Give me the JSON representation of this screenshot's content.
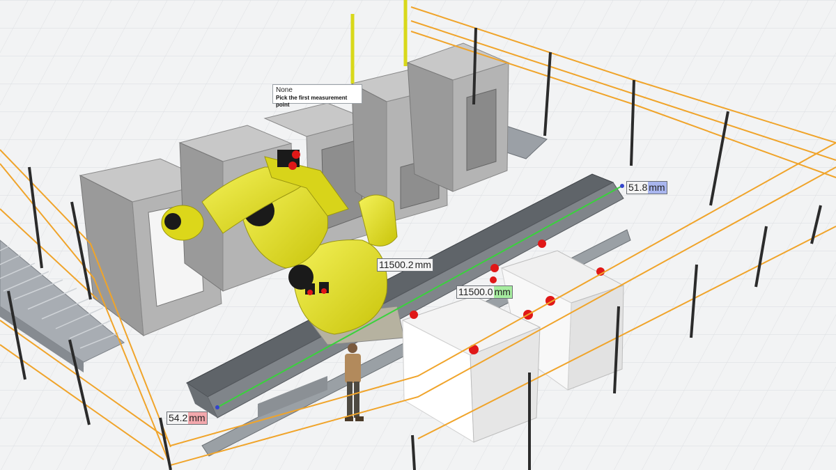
{
  "tooltip": {
    "title": "None",
    "instruction": "Pick the first measurement point"
  },
  "measurements": [
    {
      "id": "start-offset",
      "value": "54.2",
      "unit": "mm",
      "unit_color": "#f3a8ad"
    },
    {
      "id": "end-offset",
      "value": "51.8",
      "unit": "mm",
      "unit_color": "#a9b6ef"
    },
    {
      "id": "rail-length",
      "value": "11500.2",
      "unit": "mm",
      "unit_color": "#f4f4f4"
    },
    {
      "id": "measured-distance",
      "value": "11500.0",
      "unit": "mm",
      "unit_color": "#a6ec9f"
    }
  ],
  "colors": {
    "floor": "#f2f3f4",
    "fence_rail": "#f0a42a",
    "fence_post": "#2b2b2b",
    "robot": "#e6e21e",
    "machine": "#a9a9a9",
    "measure_line": "#39d23c",
    "beacon": "#e01818"
  }
}
